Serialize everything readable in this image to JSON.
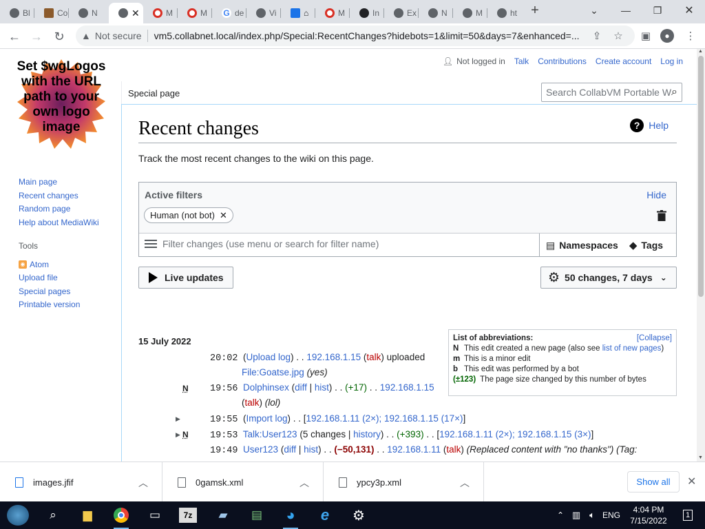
{
  "browser": {
    "tabs": [
      {
        "label": "Bl",
        "color": "#5f6368"
      },
      {
        "label": "Co",
        "color": "#8b5a2b"
      },
      {
        "label": "N",
        "color": "#5f6368"
      },
      {
        "label": "",
        "color": "#5f6368",
        "active": true
      },
      {
        "label": "M",
        "color": "#d93025"
      },
      {
        "label": "M",
        "color": "#d93025"
      },
      {
        "label": "de",
        "color": "#4285f4"
      },
      {
        "label": "Vi",
        "color": "#5f6368"
      },
      {
        "label": "",
        "color": "#1a73e8"
      },
      {
        "label": "M",
        "color": "#d93025"
      },
      {
        "label": "In",
        "color": "#202124"
      },
      {
        "label": "Ex",
        "color": "#5f6368"
      },
      {
        "label": "N",
        "color": "#5f6368"
      },
      {
        "label": "M",
        "color": "#5f6368"
      },
      {
        "label": "ht",
        "color": "#5f6368"
      }
    ],
    "not_secure": "Not secure",
    "url": "vm5.collabnet.local/index.php/Special:RecentChanges?hidebots=1&limit=50&days=7&enhanced=..."
  },
  "logo": {
    "text": "Set $wgLogos with the URL path to your own logo image"
  },
  "sidebar": {
    "nav": [
      "Main page",
      "Recent changes",
      "Random page",
      "Help about MediaWiki"
    ],
    "tools_heading": "Tools",
    "tools": [
      "Atom",
      "Upload file",
      "Special pages",
      "Printable version"
    ]
  },
  "personal": {
    "not_logged_in": "Not logged in",
    "talk": "Talk",
    "contributions": "Contributions",
    "create_account": "Create account",
    "login": "Log in"
  },
  "tab": {
    "special_page": "Special page"
  },
  "search": {
    "placeholder": "Search CollabVM Portable W"
  },
  "page": {
    "title": "Recent changes",
    "help": "Help",
    "intro": "Track the most recent changes to the wiki on this page."
  },
  "filters": {
    "heading": "Active filters",
    "hide": "Hide",
    "chip": "Human (not bot)",
    "input_placeholder": "Filter changes (use menu or search for filter name)",
    "namespaces": "Namespaces",
    "tags": "Tags",
    "live_updates": "Live updates",
    "settings": "50 changes, 7 days"
  },
  "abbreviations": {
    "title": "List of abbreviations:",
    "collapse": "[Collapse]",
    "rows": [
      {
        "key": "N",
        "text": "This edit created a new page (also see ",
        "link": "list of new pages",
        "tail": ")"
      },
      {
        "key": "m",
        "text": "This is a minor edit"
      },
      {
        "key": "b",
        "text": "This edit was performed by a bot"
      },
      {
        "key": "(±123)",
        "text": "The page size changed by this number of bytes"
      }
    ]
  },
  "changes": {
    "date": "15 July 2022",
    "rows": [
      {
        "time": "20:02",
        "log": "Upload log",
        "user": "192.168.1.15",
        "talk": "talk",
        "action": "uploaded",
        "file": "File:Goatse.jpg",
        "summary": "(yes)"
      },
      {
        "flag": "N",
        "time": "19:56",
        "page": "Dolphinsex",
        "diff": "diff",
        "hist": "hist",
        "size": "(+17)",
        "user": "192.168.1.15",
        "talk": "talk",
        "summary": "(lol)"
      },
      {
        "time": "19:55",
        "log": "Import log",
        "users": "192.168.1.11 (2×); 192.168.1.15 (17×)"
      },
      {
        "flag": "N",
        "time": "19:53",
        "page": "Talk:User123",
        "changes": "5 changes",
        "history": "history",
        "size": "(+393)",
        "users": "192.168.1.11 (2×); 192.168.1.15 (3×)"
      },
      {
        "time": "19:49",
        "page": "User123",
        "diff": "diff",
        "hist": "hist",
        "size": "(−50,131)",
        "user": "192.168.1.11",
        "talk": "talk",
        "summary": "(Replaced content with \"no thanks\")",
        "tag": "(Tag:"
      }
    ]
  },
  "downloads": {
    "items": [
      "images.jfif",
      "0gamsk.xml",
      "ypcy3p.xml"
    ],
    "show_all": "Show all"
  },
  "taskbar": {
    "lang": "ENG",
    "time": "4:04 PM",
    "date": "7/15/2022",
    "notifications": "1"
  }
}
